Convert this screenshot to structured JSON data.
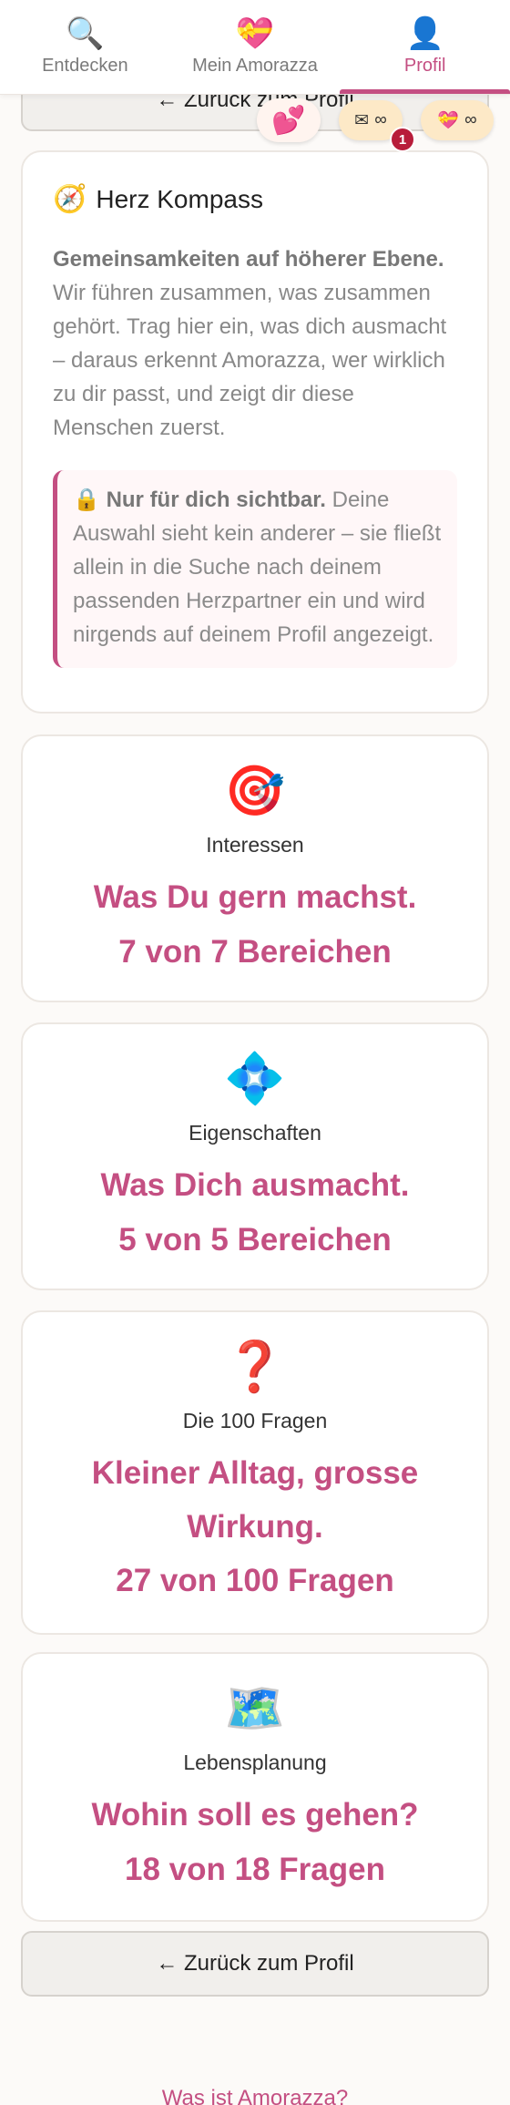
{
  "nav": {
    "tabs": [
      {
        "icon": "🔍",
        "label": "Entdecken"
      },
      {
        "icon": "💝",
        "label": "Mein Amorazza"
      },
      {
        "icon": "👤",
        "label": "Profil"
      }
    ]
  },
  "back_label": "← Zurück zum Profil",
  "badges": {
    "hearts_icon": "💕",
    "mail_icon": "✉",
    "mail_value": "∞",
    "gift_icon": "💝",
    "gift_value": "∞",
    "notification_count": "1"
  },
  "intro": {
    "icon": "🧭",
    "title": "Herz Kompass",
    "lead_bold": "Gemeinsamkeiten auf höherer Ebene.",
    "lead_text": " Wir führen zusammen, was zusammen gehört. Trag hier ein, was dich ausmacht – daraus erkennt Amorazza, wer wirklich zu dir passt, und zeigt dir diese Menschen zuerst.",
    "notice_icon": "🔒",
    "notice_bold": "Nur für dich sichtbar.",
    "notice_text": " Deine Auswahl sieht kein anderer – sie fließt allein in die Suche nach deinem passenden Herzpartner ein und wird nirgends auf deinem Profil angezeigt."
  },
  "categories": [
    {
      "icon": "🎯",
      "label": "Interessen",
      "headline": "Was Du gern machst.",
      "count": "7 von 7 Bereichen"
    },
    {
      "icon": "💠",
      "label": "Eigenschaften",
      "headline": "Was Dich ausmacht.",
      "count": "5 von 5 Bereichen"
    },
    {
      "icon": "❓",
      "label": "Die 100 Fragen",
      "headline": "Kleiner Alltag, grosse Wirkung.",
      "count": "27 von 100 Fragen"
    },
    {
      "icon": "🗺️",
      "label": "Lebensplanung",
      "headline": "Wohin soll es gehen?",
      "count": "18 von 18 Fragen"
    }
  ],
  "footer": {
    "link": "Was ist Amorazza?"
  },
  "colors": {
    "accent": "#c44f82",
    "badge_bg": "#fde9c7",
    "notification": "#b81d3a"
  }
}
